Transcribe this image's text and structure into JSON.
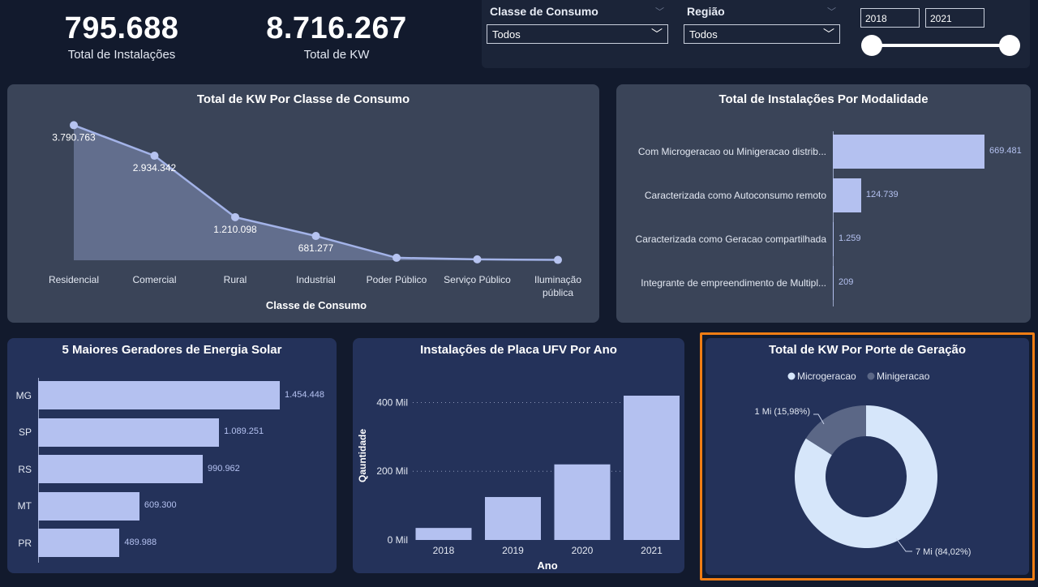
{
  "kpis": [
    {
      "value": "795.688",
      "label": "Total de Instalações"
    },
    {
      "value": "8.716.267",
      "label": "Total de KW"
    }
  ],
  "filters": {
    "classe": {
      "title": "Classe de Consumo",
      "value": "Todos"
    },
    "regiao": {
      "title": "Região",
      "value": "Todos"
    },
    "year_start": "2018",
    "year_end": "2021",
    "year_range": [
      2018,
      2021
    ]
  },
  "colors": {
    "bg": "#121a2d",
    "card_gray": "#3a4458",
    "card_blue": "#24325a",
    "bar": "#b4c1f0",
    "area_line": "#a3b3e8",
    "donut_micro": "#d6e6fa",
    "donut_mini": "#5b6786",
    "highlight": "#f07d14"
  },
  "chart_data": [
    {
      "type": "area",
      "title": "Total de KW Por Classe de Consumo",
      "xlabel": "Classe de Consumo",
      "categories": [
        "Residencial",
        "Comercial",
        "Rural",
        "Industrial",
        "Poder Público",
        "Serviço Público",
        "Iluminação pública"
      ],
      "category_lines": [
        [
          "Residencial"
        ],
        [
          "Comercial"
        ],
        [
          "Rural"
        ],
        [
          "Industrial"
        ],
        [
          "Poder Público"
        ],
        [
          "Serviço Público"
        ],
        [
          "Iluminação",
          "pública"
        ]
      ],
      "values": [
        3790763,
        2934342,
        1210098,
        681277,
        70000,
        25000,
        10000
      ],
      "labels": [
        "3.790.763",
        "2.934.342",
        "1.210.098",
        "681.277",
        "",
        "",
        ""
      ],
      "ylim": [
        0,
        3800000
      ]
    },
    {
      "type": "bar",
      "orientation": "horizontal",
      "title": "Total de Instalações Por Modalidade",
      "categories": [
        "Com Microgeracao ou Minigeracao distrib...",
        "Caracterizada como Autoconsumo remoto",
        "Caracterizada como Geracao compartilhada",
        "Integrante de empreendimento de Multipl..."
      ],
      "values": [
        669481,
        124739,
        1259,
        209
      ],
      "labels": [
        "669.481",
        "124.739",
        "1.259",
        "209"
      ]
    },
    {
      "type": "bar",
      "orientation": "horizontal",
      "title": "5 Maiores Geradores de Energia Solar",
      "categories": [
        "MG",
        "SP",
        "RS",
        "MT",
        "PR"
      ],
      "values": [
        1454448,
        1089251,
        990962,
        609300,
        489988
      ],
      "labels": [
        "1.454.448",
        "1.089.251",
        "990.962",
        "609.300",
        "489.988"
      ]
    },
    {
      "type": "bar",
      "title": "Instalações de Placa UFV Por Ano",
      "xlabel": "Ano",
      "ylabel": "Qauntidade",
      "categories": [
        "2018",
        "2019",
        "2020",
        "2021"
      ],
      "values": [
        35000,
        125000,
        220000,
        420000
      ],
      "yticks": [
        0,
        200000,
        400000
      ],
      "ytick_labels": [
        "0 Mil",
        "200 Mil",
        "400 Mil"
      ],
      "ylim": [
        0,
        420000
      ],
      "grid": true
    },
    {
      "type": "pie",
      "donut": true,
      "title": "Total de KW Por Porte de Geração",
      "legend": [
        "Microgeracao",
        "Minigeracao"
      ],
      "legend_position": "top",
      "values": [
        84.02,
        15.98
      ],
      "labels": [
        "7 Mi (84,02%)",
        "1 Mi (15,98%)"
      ]
    }
  ]
}
